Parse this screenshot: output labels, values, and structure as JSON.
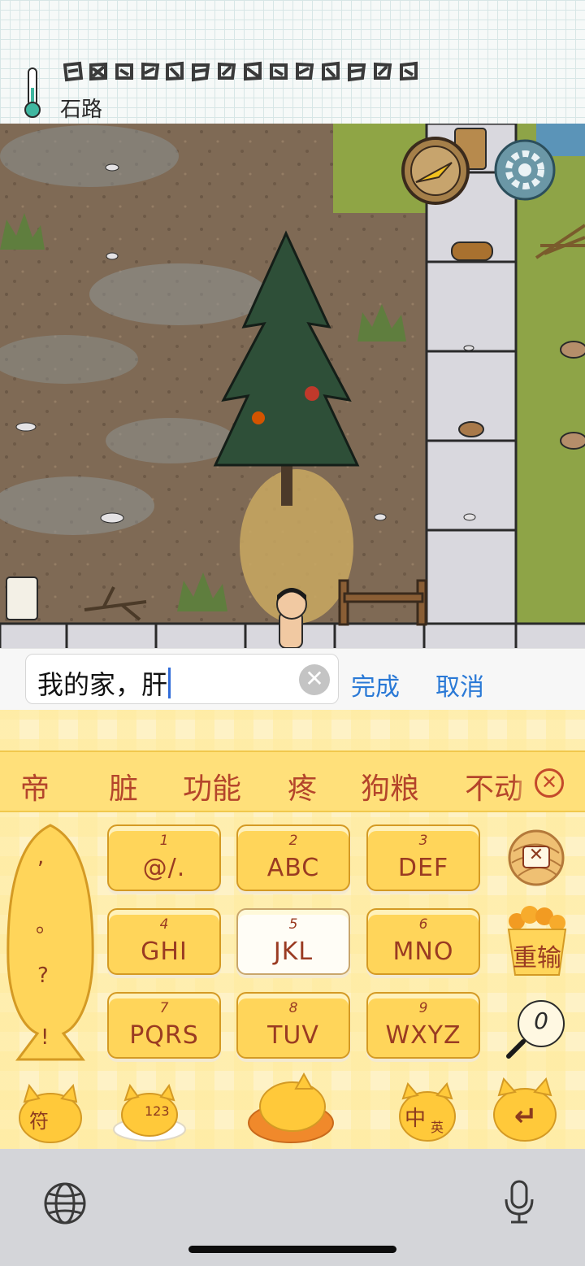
{
  "status": {
    "biome_label": "石路",
    "icons": [
      "thermometer-icon"
    ]
  },
  "hud": {
    "compass_icon": "compass-icon",
    "settings_icon": "gear-icon"
  },
  "input": {
    "value": "我的家，肝",
    "clear_icon": "✕",
    "done_label": "完成",
    "cancel_label": "取消"
  },
  "candidates": [
    "帝",
    "脏",
    "功能",
    "疼",
    "狗粮",
    "不动"
  ],
  "candidate_close": "✕",
  "keys": [
    {
      "num": "1",
      "label": "@/."
    },
    {
      "num": "2",
      "label": "ABC"
    },
    {
      "num": "3",
      "label": "DEF"
    },
    {
      "num": "4",
      "label": "GHI"
    },
    {
      "num": "5",
      "label": "JKL"
    },
    {
      "num": "6",
      "label": "MNO"
    },
    {
      "num": "7",
      "label": "PQRS"
    },
    {
      "num": "8",
      "label": "TUV"
    },
    {
      "num": "9",
      "label": "WXYZ"
    }
  ],
  "punctuation": [
    ",",
    "。",
    "?",
    "!"
  ],
  "side_keys": {
    "delete_label": "✕",
    "retype_label": "重输",
    "zero_label": "0"
  },
  "bottom_keys": {
    "symbol_label": "符",
    "numeric_label": "123",
    "lang_zh": "中",
    "lang_en": "英",
    "enter_label": "↵"
  },
  "colors": {
    "link_blue": "#2a79d6",
    "key_fill": "#ffd55a",
    "candidate_text": "#b4452b",
    "path_stone": "#d9d8de"
  }
}
